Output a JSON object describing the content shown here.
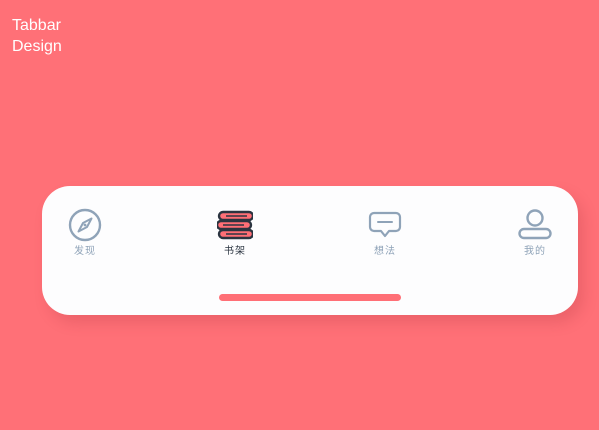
{
  "header": {
    "title_line1": "Tabbar",
    "title_line2": "Design"
  },
  "tabbar": {
    "active_tab": "书架",
    "tabs": [
      {
        "label": "发现",
        "icon": "compass-icon"
      },
      {
        "label": "书架",
        "icon": "bookshelf-icon"
      },
      {
        "label": "想法",
        "icon": "chat-bubble-icon"
      },
      {
        "label": "我的",
        "icon": "user-icon"
      }
    ]
  },
  "colors": {
    "background": "#ff7077",
    "accent": "#ff6f76",
    "icon_inactive": "#8fa3b8",
    "icon_active_outline": "#2b3440",
    "tabbar_bg": "#fdfdfe"
  }
}
